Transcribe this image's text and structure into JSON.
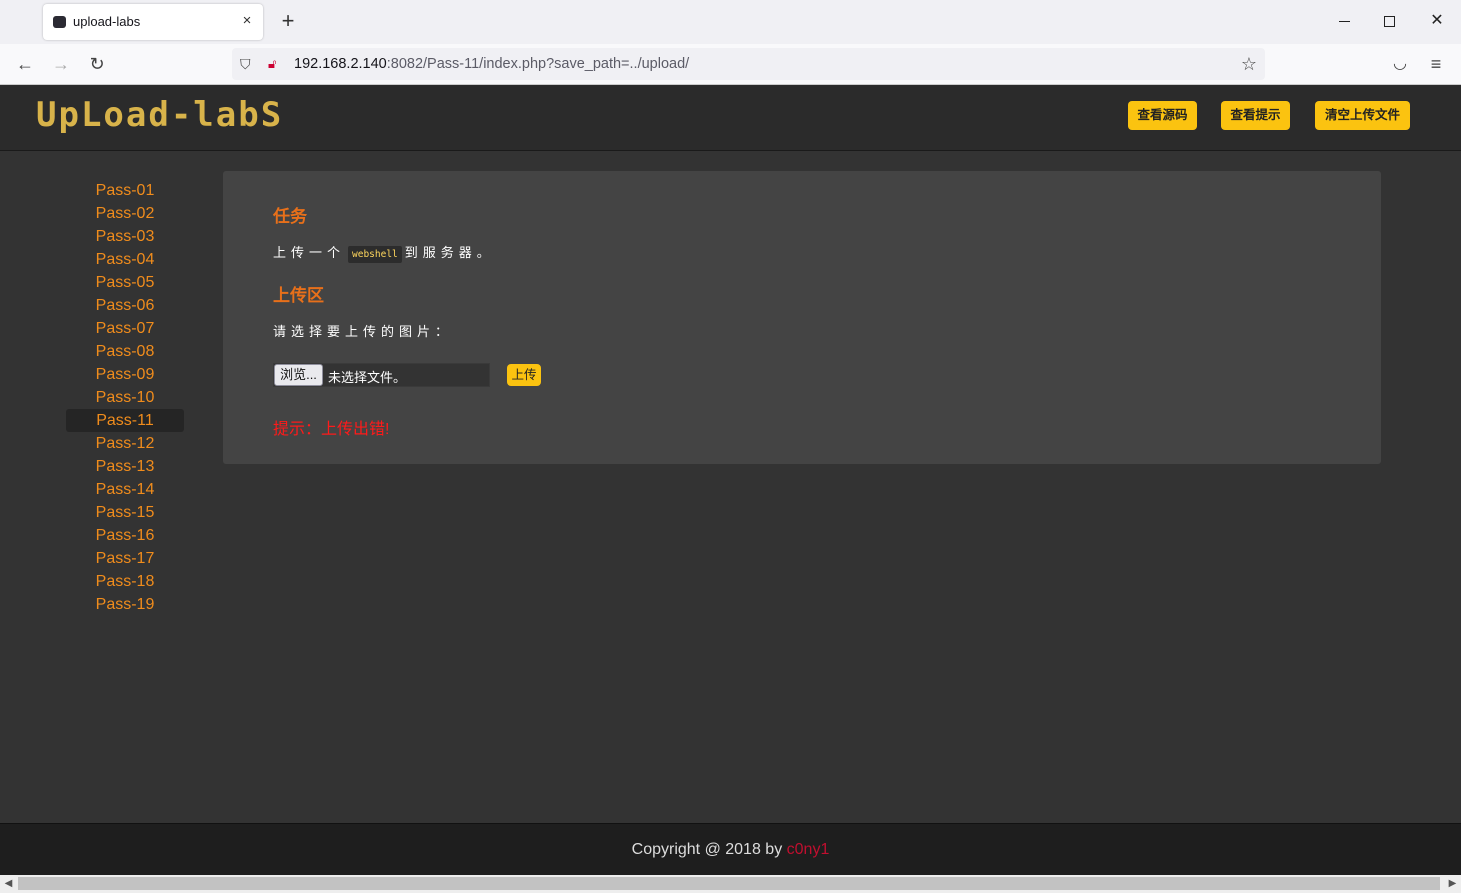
{
  "browser": {
    "tab_title": "upload-labs",
    "tab_close": "×",
    "new_tab": "+",
    "url_host": "192.168.2.140",
    "url_rest": ":8082/Pass-11/index.php?save_path=../upload/",
    "icons": [
      "back-icon",
      "forward-icon",
      "reload-icon",
      "shield-icon",
      "lock-warning-icon",
      "star-icon",
      "pocket-icon",
      "menu-icon"
    ]
  },
  "header": {
    "logo": "UpLoad-labS",
    "buttons": [
      "查看源码",
      "查看提示",
      "清空上传文件"
    ],
    "button_color": "#fbc310"
  },
  "sidebar": {
    "items": [
      "Pass-01",
      "Pass-02",
      "Pass-03",
      "Pass-04",
      "Pass-05",
      "Pass-06",
      "Pass-07",
      "Pass-08",
      "Pass-09",
      "Pass-10",
      "Pass-11",
      "Pass-12",
      "Pass-13",
      "Pass-14",
      "Pass-15",
      "Pass-16",
      "Pass-17",
      "Pass-18",
      "Pass-19"
    ],
    "active": "Pass-11",
    "link_color": "#f08c1c"
  },
  "main": {
    "task_heading": "任务",
    "task_text_before": "上传一个",
    "task_code": "webshell",
    "task_text_after": "到服务器。",
    "upload_heading": "上传区",
    "select_prompt": "请选择要上传的图片：",
    "browse_label": "浏览...",
    "file_status": "未选择文件。",
    "upload_button": "上传",
    "message": "提示：上传出错!",
    "heading_color": "#e8701a",
    "message_color": "#ff1a1a"
  },
  "footer": {
    "copyright": "Copyright @ 2018 by ",
    "author": "c0ny1",
    "author_color": "#c00f2f"
  }
}
